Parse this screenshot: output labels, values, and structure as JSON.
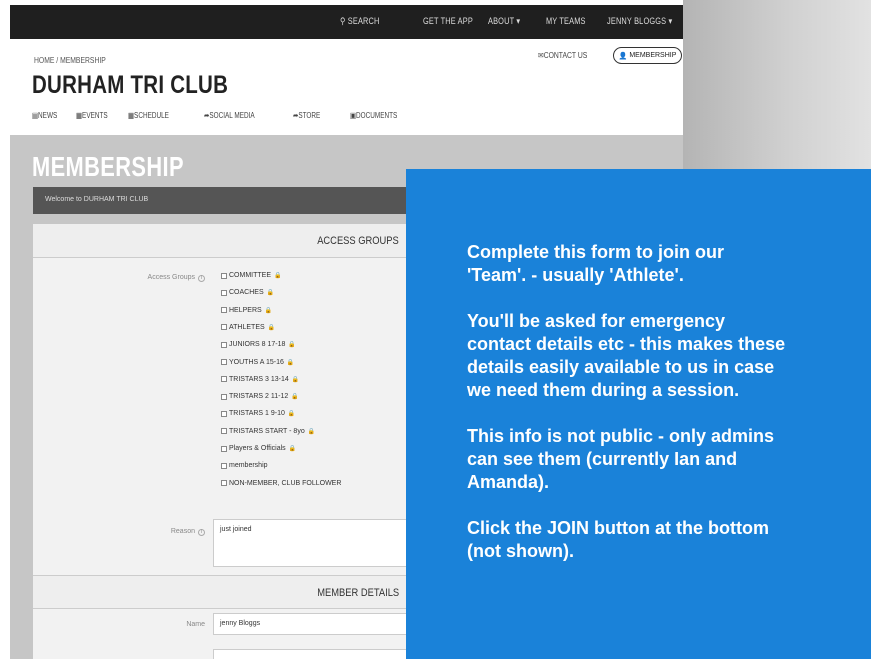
{
  "topbar": {
    "search": "SEARCH",
    "get_app": "GET THE APP",
    "about": "ABOUT",
    "my_teams": "MY TEAMS",
    "user": "JENNY BLOGGS"
  },
  "header": {
    "breadcrumb": "HOME / MEMBERSHIP",
    "club_name": "DURHAM TRI CLUB",
    "contact_label": "CONTACT US",
    "membership_button": "MEMBERSHIP",
    "nav": [
      "NEWS",
      "EVENTS",
      "SCHEDULE",
      "SOCIAL MEDIA",
      "STORE",
      "DOCUMENTS"
    ]
  },
  "page": {
    "title": "MEMBERSHIP",
    "welcome": "Welcome to DURHAM TRI CLUB"
  },
  "form": {
    "access_header": "ACCESS GROUPS",
    "access_label": "Access Groups",
    "groups": [
      {
        "name": "COMMITTEE",
        "locked": true
      },
      {
        "name": "COACHES",
        "locked": true
      },
      {
        "name": "HELPERS",
        "locked": true
      },
      {
        "name": "ATHLETES",
        "locked": true
      },
      {
        "name": "JUNIORS 8 17-18",
        "locked": true
      },
      {
        "name": "YOUTHS A 15-16",
        "locked": true
      },
      {
        "name": "TRISTARS 3 13-14",
        "locked": true
      },
      {
        "name": "TRISTARS 2 11-12",
        "locked": true
      },
      {
        "name": "TRISTARS 1 9-10",
        "locked": true
      },
      {
        "name": "TRISTARS START - 8yo",
        "locked": true
      },
      {
        "name": "Players & Officials",
        "locked": true
      },
      {
        "name": "membership",
        "locked": false
      },
      {
        "name": "NON-MEMBER, CLUB FOLLOWER",
        "locked": false
      }
    ],
    "reason_label": "Reason",
    "reason_value": "just joined",
    "member_header": "MEMBER DETAILS",
    "name_label": "Name",
    "name_value": "jenny Bloggs"
  },
  "overlay": {
    "paragraphs": [
      "Complete this form to join our\n'Team'. - usually 'Athlete'.",
      "You'll be asked for emergency\ncontact details etc - this makes these\ndetails easily available to us in case\nwe need them during a session.",
      "This info is not public - only admins\ncan see them (currently Ian and\nAmanda).",
      "Click the JOIN button at the bottom\n(not shown)."
    ]
  },
  "colors": {
    "overlay_bg": "#1a82d9",
    "topbar_bg": "#1f1f1f",
    "page_bg": "#c6c6c6"
  }
}
